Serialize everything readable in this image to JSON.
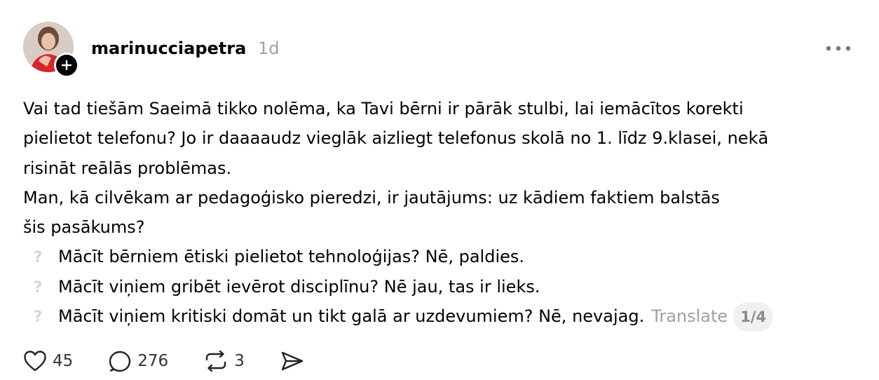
{
  "post": {
    "username": "marinucciapetra",
    "time": "1d",
    "lines": [
      "Vai tad tiešām Saeimā tikko nolēma, ka Tavi bērni ir pārāk stulbi, lai iemācītos korekti",
      "pielietot telefonu? Jo ir daaaaudz vieglāk aizliegt telefonus skolā no 1. līdz 9.klasei, nekā",
      "risināt reālās problēmas.",
      "Man, kā cilvēkam ar pedagoģisko pieredzi, ir jautājums: uz kādiem faktiem balstās",
      "šis pasākums?"
    ],
    "bullets": [
      "Mācīt bērniem ētiski pielietot tehnoloģijas? Nē, paldies.",
      "Mācīt viņiem gribēt ievērot disciplīnu? Nē jau, tas ir lieks.",
      "Mācīt viņiem kritiski domāt un tikt galā ar uzdevumiem? Nē, nevajag."
    ],
    "bullet_icon": "question-mark-icon",
    "translate_label": "Translate",
    "page_indicator": "1/4"
  },
  "actions": {
    "likes": "45",
    "replies": "276",
    "reposts": "3"
  },
  "icons": {
    "like": "heart-icon",
    "reply": "speech-bubble-icon",
    "repost": "repost-icon",
    "share": "send-icon",
    "more": "more-icon",
    "follow": "plus-icon"
  }
}
